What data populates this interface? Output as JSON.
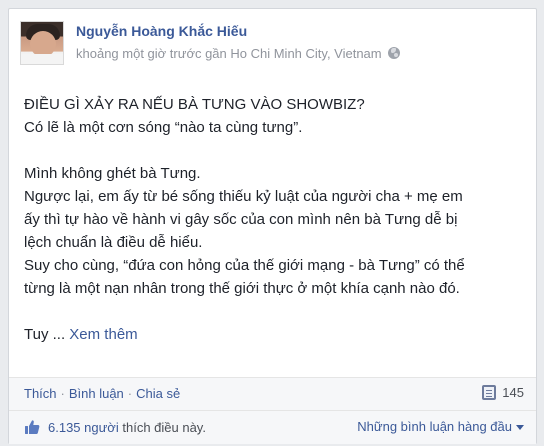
{
  "post": {
    "author": "Nguyễn Hoàng Khắc Hiếu",
    "timestamp": "khoảng một giờ trước gần Ho Chi Minh City, Vietnam",
    "privacy_icon": "globe-icon",
    "lines": [
      "ĐIỀU GÌ XẢY RA NẾU BÀ TƯNG VÀO SHOWBIZ?",
      "Có lẽ là một cơn sóng “nào ta cùng tưng”.",
      "Mình không ghét bà Tưng.",
      "Ngược lại, em ấy từ bé sống thiếu kỷ luật của người cha + mẹ em",
      "ấy thì tự hào về hành vi gây sốc của con mình nên bà Tưng dễ bị",
      "lệch chuẩn là điều dễ hiểu.",
      "Suy cho cùng, “đứa con hỏng của thế giới mạng - bà Tưng” có thể",
      "từng là một nạn nhân trong thế giới thực ở một khía cạnh nào đó."
    ],
    "truncated_prefix": "Tuy ...",
    "see_more": "Xem thêm"
  },
  "actions": {
    "like": "Thích",
    "comment": "Bình luận",
    "share": "Chia sẻ",
    "share_count": "145"
  },
  "likes": {
    "count": "6.135 người",
    "suffix": "thích điều này.",
    "top_comments": "Những bình luận hàng đầu"
  },
  "colors": {
    "link": "#3b5998",
    "text": "#1d2129",
    "muted": "#90949c"
  }
}
